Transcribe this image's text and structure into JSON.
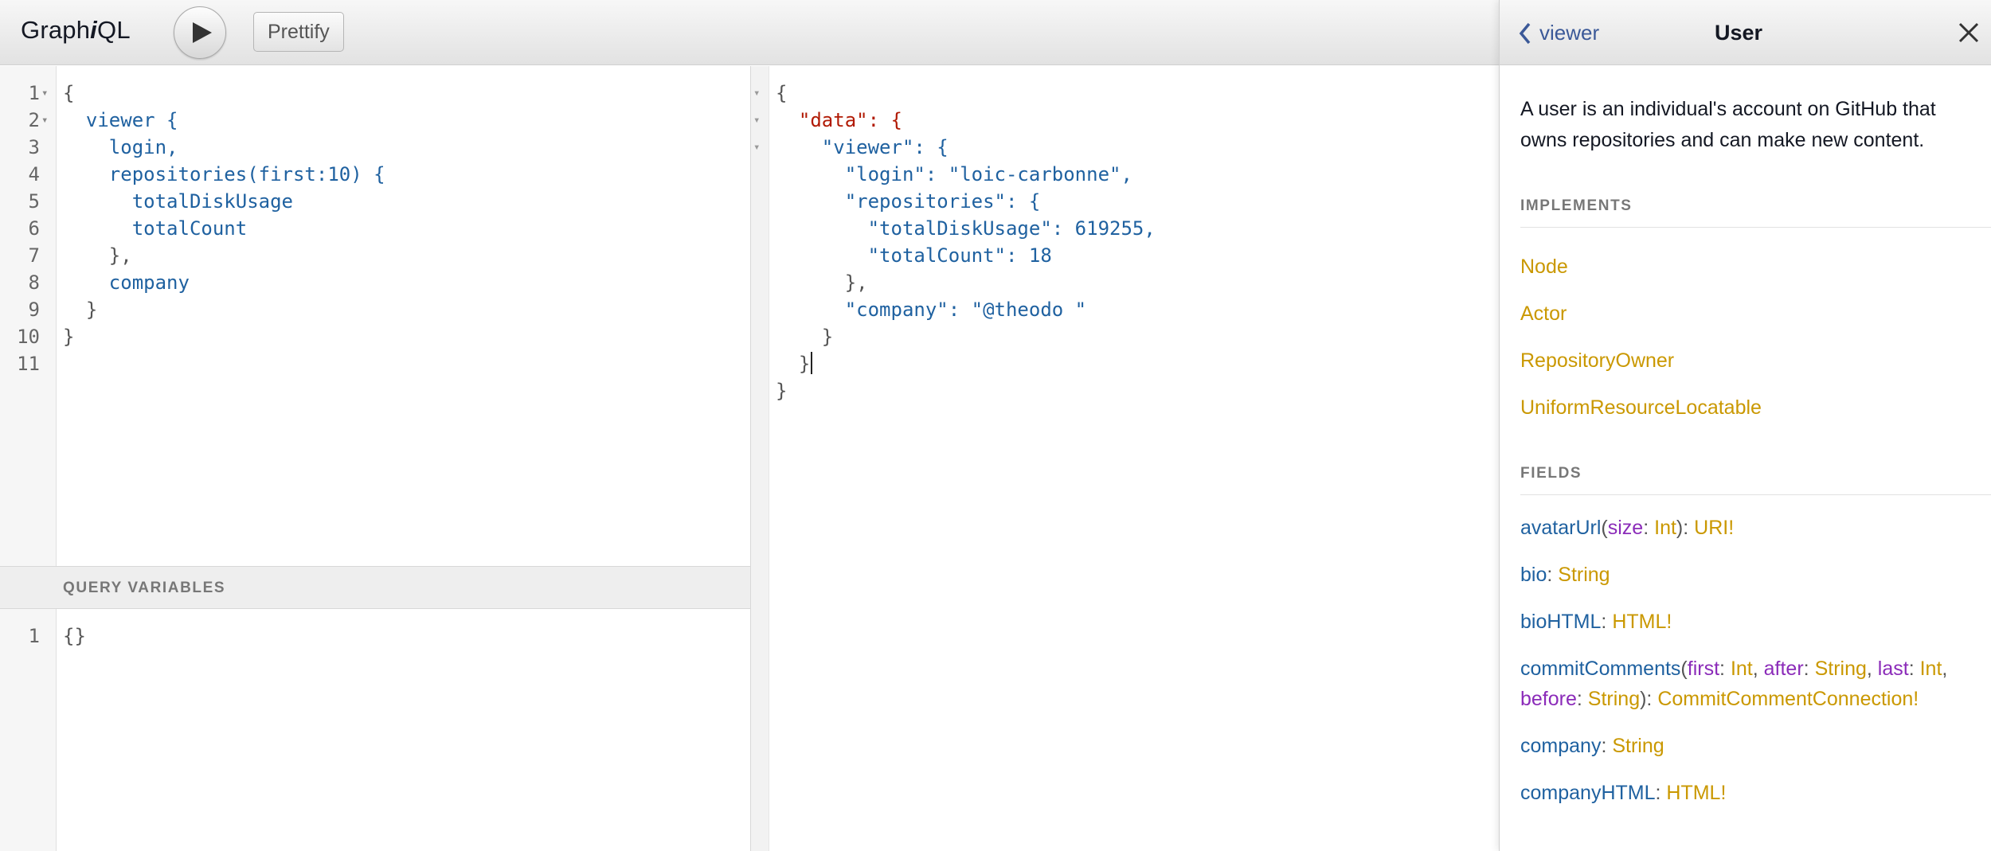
{
  "toolbar": {
    "logo_prefix": "Graph",
    "logo_italic": "i",
    "logo_suffix": "QL",
    "prettify_label": "Prettify"
  },
  "query_editor": {
    "line_numbers": [
      "1",
      "2",
      "3",
      "4",
      "5",
      "6",
      "7",
      "8",
      "9",
      "10",
      "11"
    ],
    "lines": [
      "{",
      "  viewer {",
      "    login,",
      "    repositories(first:10) {",
      "      totalDiskUsage",
      "      totalCount",
      "    },",
      "    company",
      "  }",
      "}",
      ""
    ]
  },
  "variables": {
    "title": "QUERY VARIABLES",
    "line_numbers": [
      "1"
    ],
    "lines": [
      "{}"
    ]
  },
  "result": {
    "lines": [
      "{",
      "  \"data\": {",
      "    \"viewer\": {",
      "      \"login\": \"loic-carbonne\",",
      "      \"repositories\": {",
      "        \"totalDiskUsage\": 619255,",
      "        \"totalCount\": 18",
      "      },",
      "      \"company\": \"@theodo \"",
      "    }",
      "  }",
      "}"
    ]
  },
  "doc_explorer": {
    "back_label": "viewer",
    "title": "User",
    "description": "A user is an individual's account on GitHub that owns repositories and can make new content.",
    "implements_title": "IMPLEMENTS",
    "implements": [
      "Node",
      "Actor",
      "RepositoryOwner",
      "UniformResourceLocatable"
    ],
    "fields_title": "FIELDS",
    "fields": [
      {
        "name": "avatarUrl",
        "args": [
          {
            "name": "size",
            "type": "Int"
          }
        ],
        "type": "URI!"
      },
      {
        "name": "bio",
        "args": [],
        "type": "String"
      },
      {
        "name": "bioHTML",
        "args": [],
        "type": "HTML!"
      },
      {
        "name": "commitComments",
        "args": [
          {
            "name": "first",
            "type": "Int"
          },
          {
            "name": "after",
            "type": "String"
          },
          {
            "name": "last",
            "type": "Int"
          },
          {
            "name": "before",
            "type": "String"
          }
        ],
        "type": "CommitCommentConnection!"
      },
      {
        "name": "company",
        "args": [],
        "type": "String"
      },
      {
        "name": "companyHTML",
        "args": [],
        "type": "HTML!"
      }
    ]
  },
  "colors": {
    "field": "#1f61a0",
    "argument": "#8b2bb9",
    "type": "#ca9800",
    "number": "#2882f9",
    "json_key": "#b11a04",
    "string": "#d64292",
    "link": "#3b5998"
  }
}
